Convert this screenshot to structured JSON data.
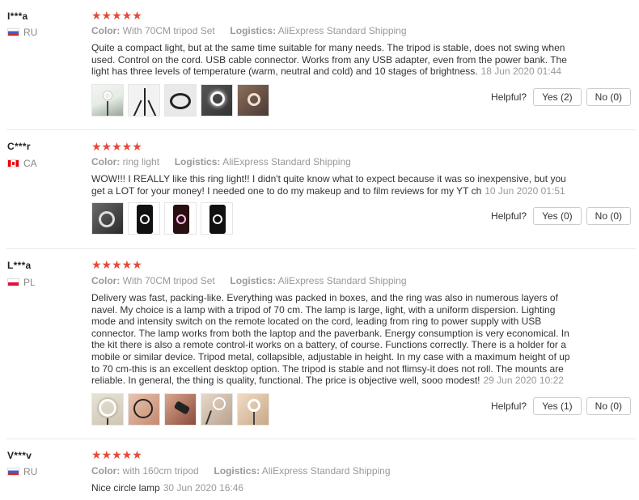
{
  "reviews": [
    {
      "user": "I***a",
      "country": "RU",
      "color_label": "Color:",
      "color_value": "With 70CM tripod Set",
      "logistics_label": "Logistics:",
      "logistics_value": "AliExpress Standard Shipping",
      "text": "Quite a compact light, but at the same time suitable for many needs. The tripod is stable, does not swing when used. Control on the cord. USB cable connector. Works from any USB adapter, even from the power bank. The light has three levels of temperature (warm, neutral and cold) and 10 stages of brightness.",
      "date": "18 Jun 2020 01:44",
      "helpful_label": "Helpful?",
      "yes": "Yes (2)",
      "no": "No (0)"
    },
    {
      "user": "C***r",
      "country": "CA",
      "color_label": "Color:",
      "color_value": "ring light",
      "logistics_label": "Logistics:",
      "logistics_value": "AliExpress Standard Shipping",
      "text": "WOW!!! I REALLY like this ring light!! I didn't quite know what to expect because it was so inexpensive, but you get a LOT for your money! I needed one to do my makeup and to film reviews for my YT ch",
      "date": "10 Jun 2020 01:51",
      "helpful_label": "Helpful?",
      "yes": "Yes (0)",
      "no": "No (0)"
    },
    {
      "user": "L***a",
      "country": "PL",
      "color_label": "Color:",
      "color_value": "With 70CM tripod Set",
      "logistics_label": "Logistics:",
      "logistics_value": "AliExpress Standard Shipping",
      "text": "Delivery was fast, packing-like. Everything was packed in boxes, and the ring was also in numerous layers of navel. My choice is a lamp with a tripod of 70 cm. The lamp is large, light, with a uniform dispersion. Lighting mode and intensity switch on the remote located on the cord, leading from ring to power supply with USB connector. The lamp works from both the laptop and the paverbank. Energy consumption is very economical. In the kit there is also a remote control-it works on a battery, of course. Functions correctly. There is a holder for a mobile or similar device. Tripod metal, collapsible, adjustable in height. In my case with a maximum height of up to 70 cm-this is an excellent desktop option. The tripod is stable and not flimsy-it does not roll. The mounts are reliable. In general, the thing is quality, functional. The price is objective well, sooo modest!",
      "date": "29 Jun 2020 10:22",
      "helpful_label": "Helpful?",
      "yes": "Yes (1)",
      "no": "No (0)"
    },
    {
      "user": "V***v",
      "country": "RU",
      "color_label": "Color:",
      "color_value": "with 160cm tripod",
      "logistics_label": "Logistics:",
      "logistics_value": "AliExpress Standard Shipping",
      "text": "Nice circle lamp",
      "date": "30 Jun 2020 16:46"
    }
  ],
  "stars_glyph": "★★★★★",
  "colors": {
    "star": "#e34a3a",
    "muted": "#999999",
    "divider": "#e8e8e8"
  }
}
